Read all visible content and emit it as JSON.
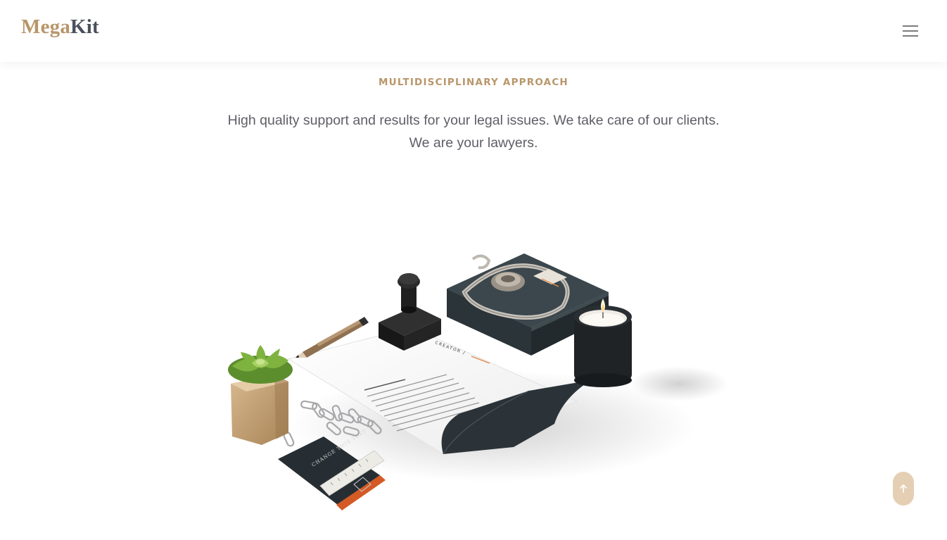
{
  "header": {
    "logo": {
      "part1": "Mega",
      "part2": "Kit"
    },
    "menu_icon": "hamburger-menu-icon"
  },
  "intro": {
    "eyebrow": "MULTIDISCIPLINARY APPROACH",
    "text": "High quality support and results for your legal issues. We take care of our clients. We are your lawyers."
  },
  "hero_image": {
    "letterhead_text": "CREATOR /",
    "card_text": "CHANGE THIS TEXT"
  },
  "scroll_top": {
    "icon": "arrow-up-icon"
  },
  "colors": {
    "accent": "#b8966a",
    "logo_dark": "#4a4f5c",
    "body_text": "#5e5e66",
    "scroll_button": "#e5cfb4"
  }
}
